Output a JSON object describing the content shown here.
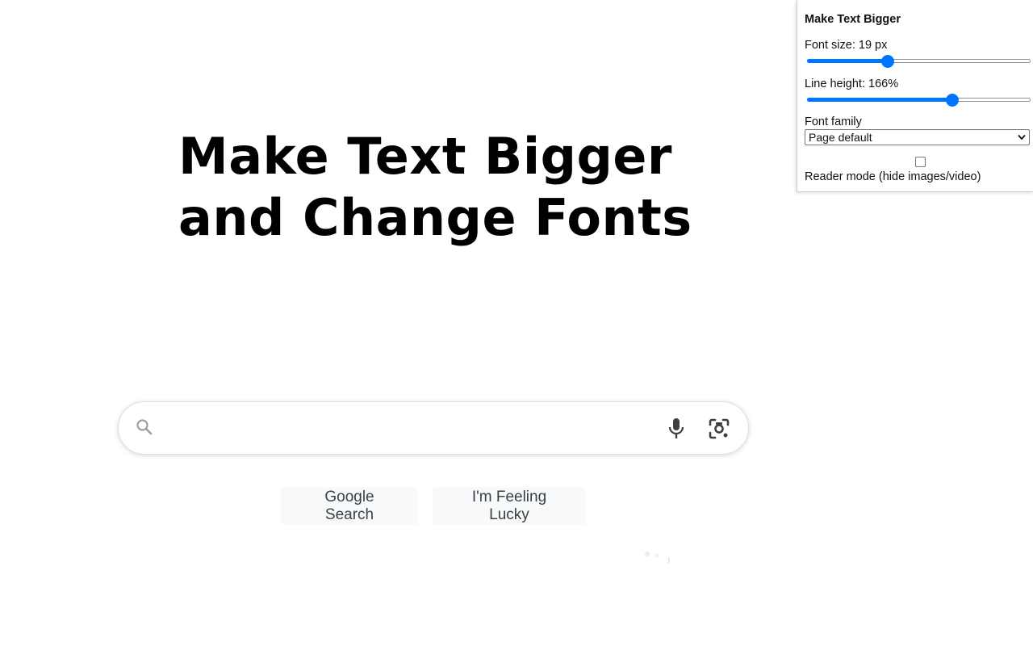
{
  "overlay": {
    "headline_line1": "Make Text Bigger",
    "headline_line2": "and Change Fonts"
  },
  "search": {
    "value": "",
    "placeholder": "",
    "icon": "search-icon",
    "mic_icon": "microphone-icon",
    "lens_icon": "camera-search-icon"
  },
  "buttons": {
    "search_label": "Google Search",
    "lucky_label": "I'm Feeling Lucky"
  },
  "extension": {
    "title": "Make Text Bigger",
    "font_size_label": "Font size: 19 px",
    "font_size_value": 19,
    "font_size_fraction": 0.36,
    "line_height_label": "Line height: 166%",
    "line_height_value": 166,
    "line_height_fraction": 0.65,
    "font_family_label": "Font family",
    "font_family_selected": "Page default",
    "reader_mode_label": "Reader mode (hide images/video)",
    "reader_mode_checked": false,
    "accent_color": "#0075ff"
  }
}
